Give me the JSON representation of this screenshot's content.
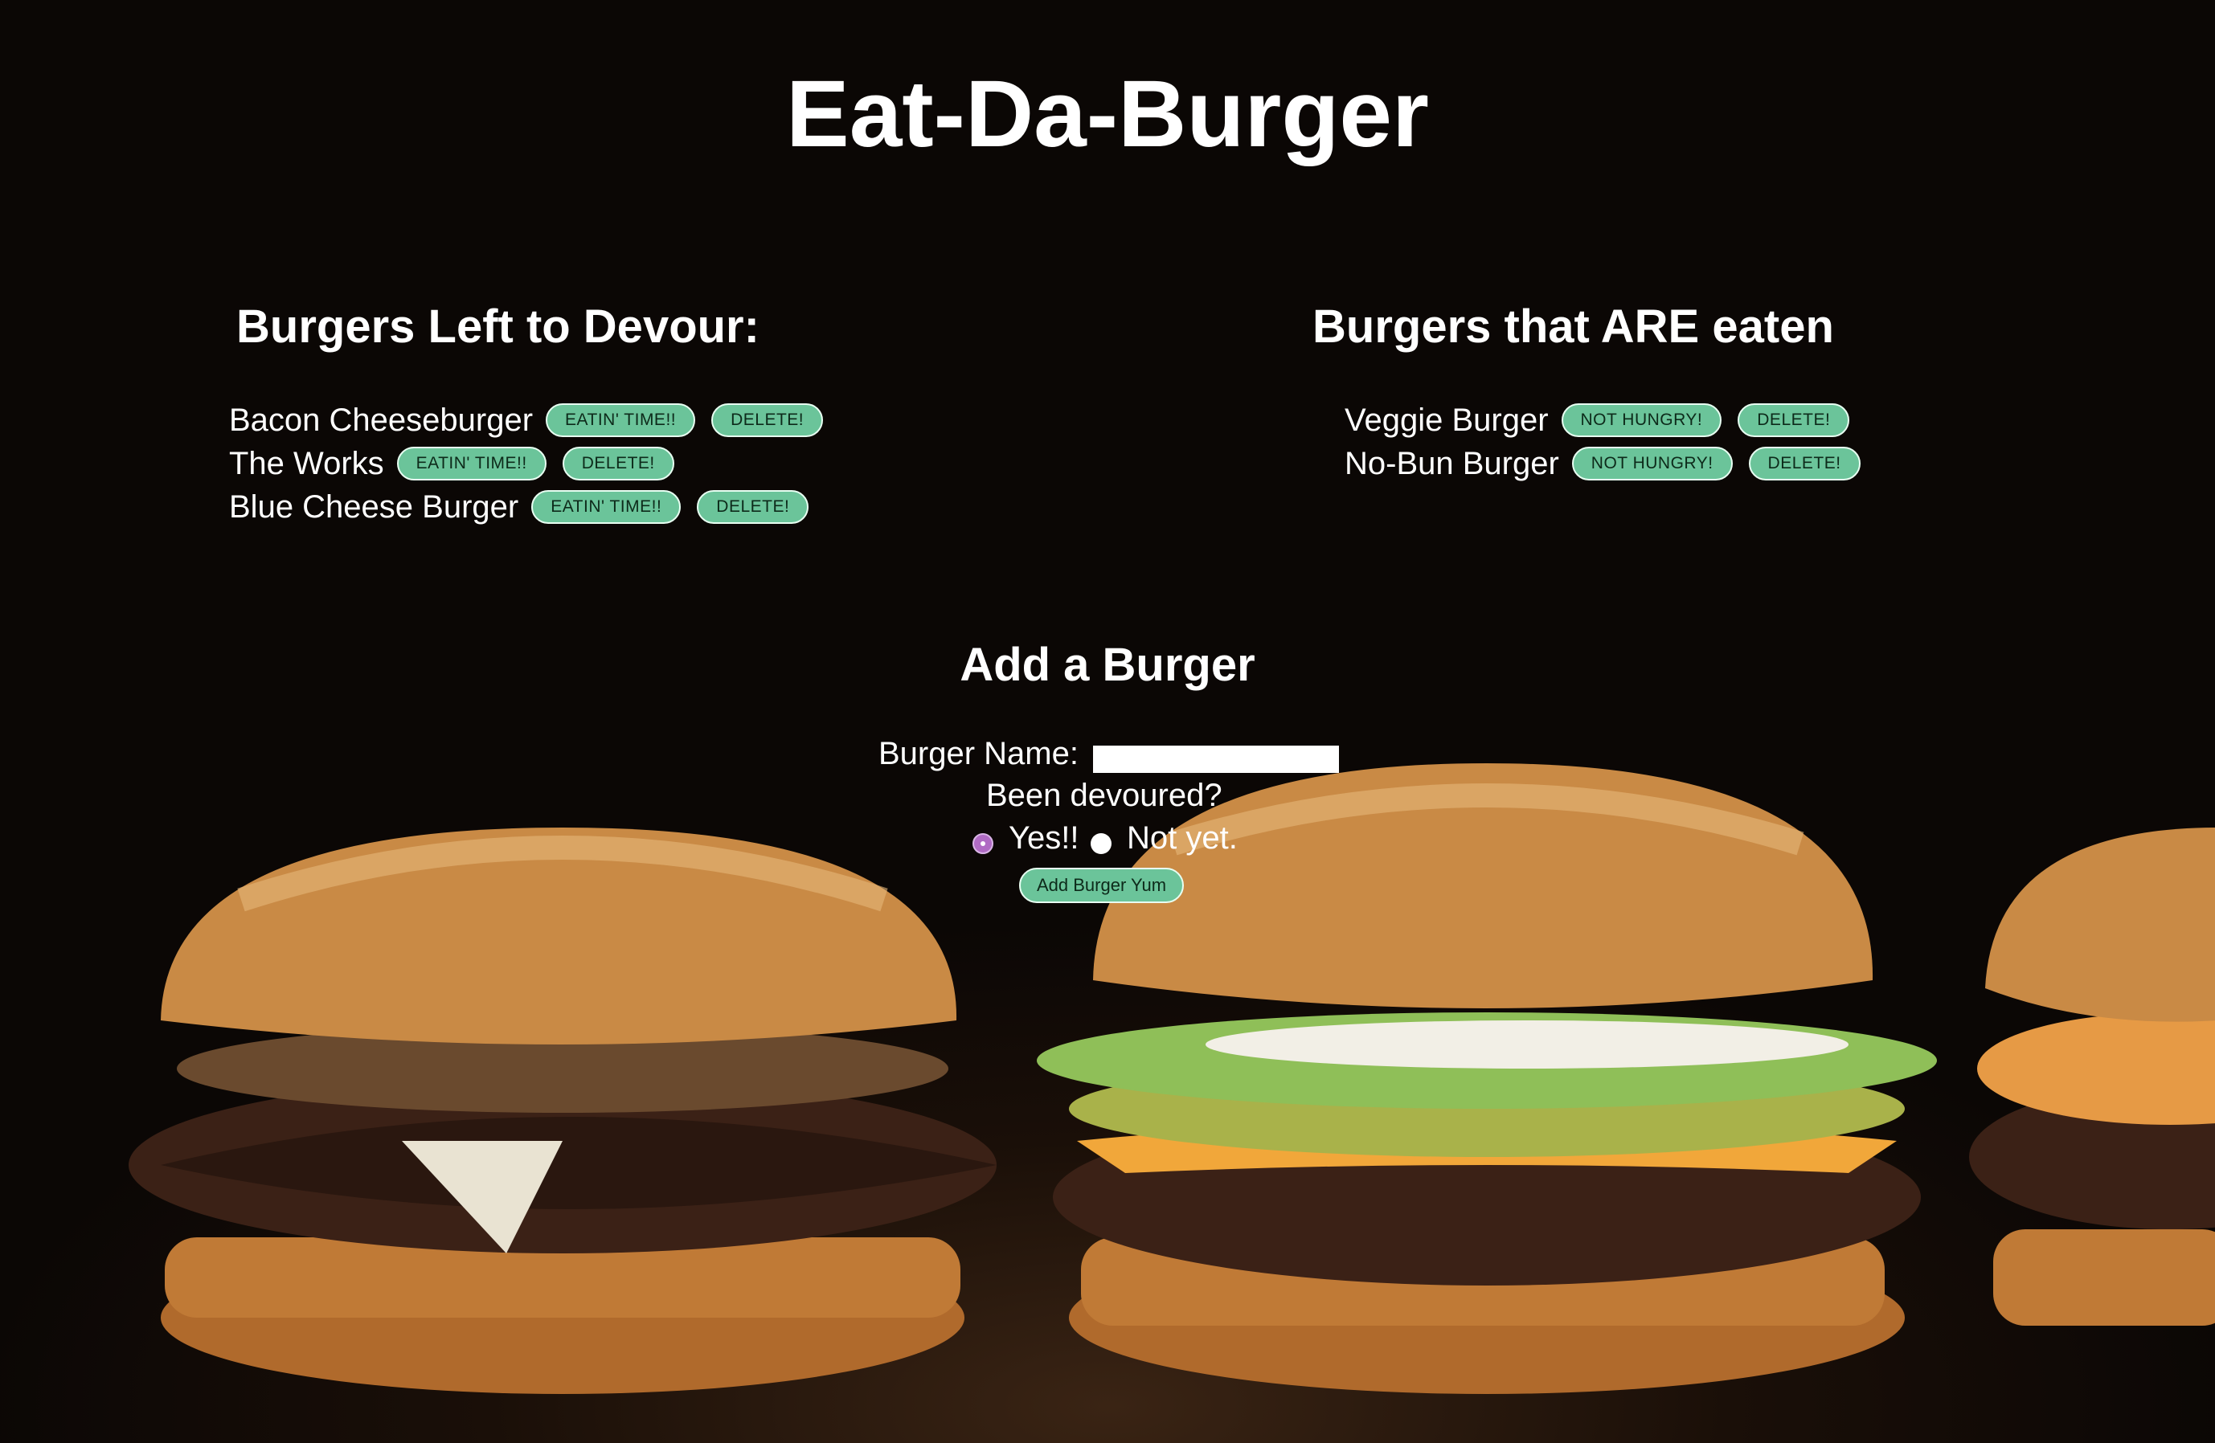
{
  "page": {
    "title": "Eat-Da-Burger"
  },
  "devour": {
    "title": "Burgers Left to Devour:",
    "items": [
      {
        "name": "Bacon Cheeseburger",
        "action": "EATIN' TIME!!",
        "delete": "DELETE!"
      },
      {
        "name": "The Works",
        "action": "EATIN' TIME!!",
        "delete": "DELETE!"
      },
      {
        "name": "Blue Cheese Burger",
        "action": "EATIN' TIME!!",
        "delete": "DELETE!"
      }
    ]
  },
  "eaten": {
    "title": "Burgers that ARE eaten",
    "items": [
      {
        "name": "Veggie Burger",
        "action": "NOT HUNGRY!",
        "delete": "DELETE!"
      },
      {
        "name": "No-Bun Burger",
        "action": "NOT HUNGRY!",
        "delete": "DELETE!"
      }
    ]
  },
  "form": {
    "title": "Add a Burger",
    "name_label": "Burger Name:",
    "name_value": "",
    "devoured_label": "Been devoured?",
    "yes_label": "Yes!!",
    "no_label": "Not yet.",
    "yes_checked": true,
    "submit_label": "Add Burger Yum"
  },
  "colors": {
    "button_bg": "#6bc49a",
    "radio_checked": "#b06bc4",
    "background": "#0b0705"
  }
}
